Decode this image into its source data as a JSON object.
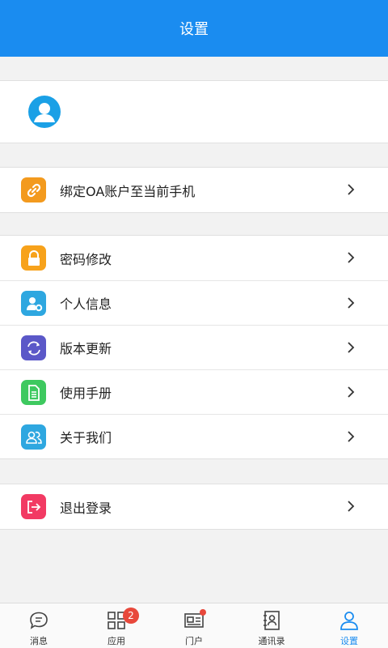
{
  "header": {
    "title": "设置"
  },
  "colors": {
    "accent": "#1a8cf0",
    "badge": "#e8483b"
  },
  "groups": [
    [
      {
        "label": "绑定OA账户至当前手机",
        "icon": "link-icon",
        "color": "#f39a1e"
      }
    ],
    [
      {
        "label": "密码修改",
        "icon": "lock-icon",
        "color": "#f7a21b"
      },
      {
        "label": "个人信息",
        "icon": "user-gear-icon",
        "color": "#2ea7e0"
      },
      {
        "label": "版本更新",
        "icon": "refresh-icon",
        "color": "#5b58c8"
      },
      {
        "label": "使用手册",
        "icon": "document-icon",
        "color": "#3ec95f"
      },
      {
        "label": "关于我们",
        "icon": "group-icon",
        "color": "#2ea7e0"
      }
    ],
    [
      {
        "label": "退出登录",
        "icon": "logout-icon",
        "color": "#f23a63"
      }
    ]
  ],
  "tabs": [
    {
      "label": "消息",
      "icon": "chat-icon"
    },
    {
      "label": "应用",
      "icon": "grid-icon",
      "badge": "2"
    },
    {
      "label": "门户",
      "icon": "news-icon",
      "dot": true
    },
    {
      "label": "通讯录",
      "icon": "contacts-icon"
    },
    {
      "label": "设置",
      "icon": "person-icon",
      "active": true
    }
  ]
}
